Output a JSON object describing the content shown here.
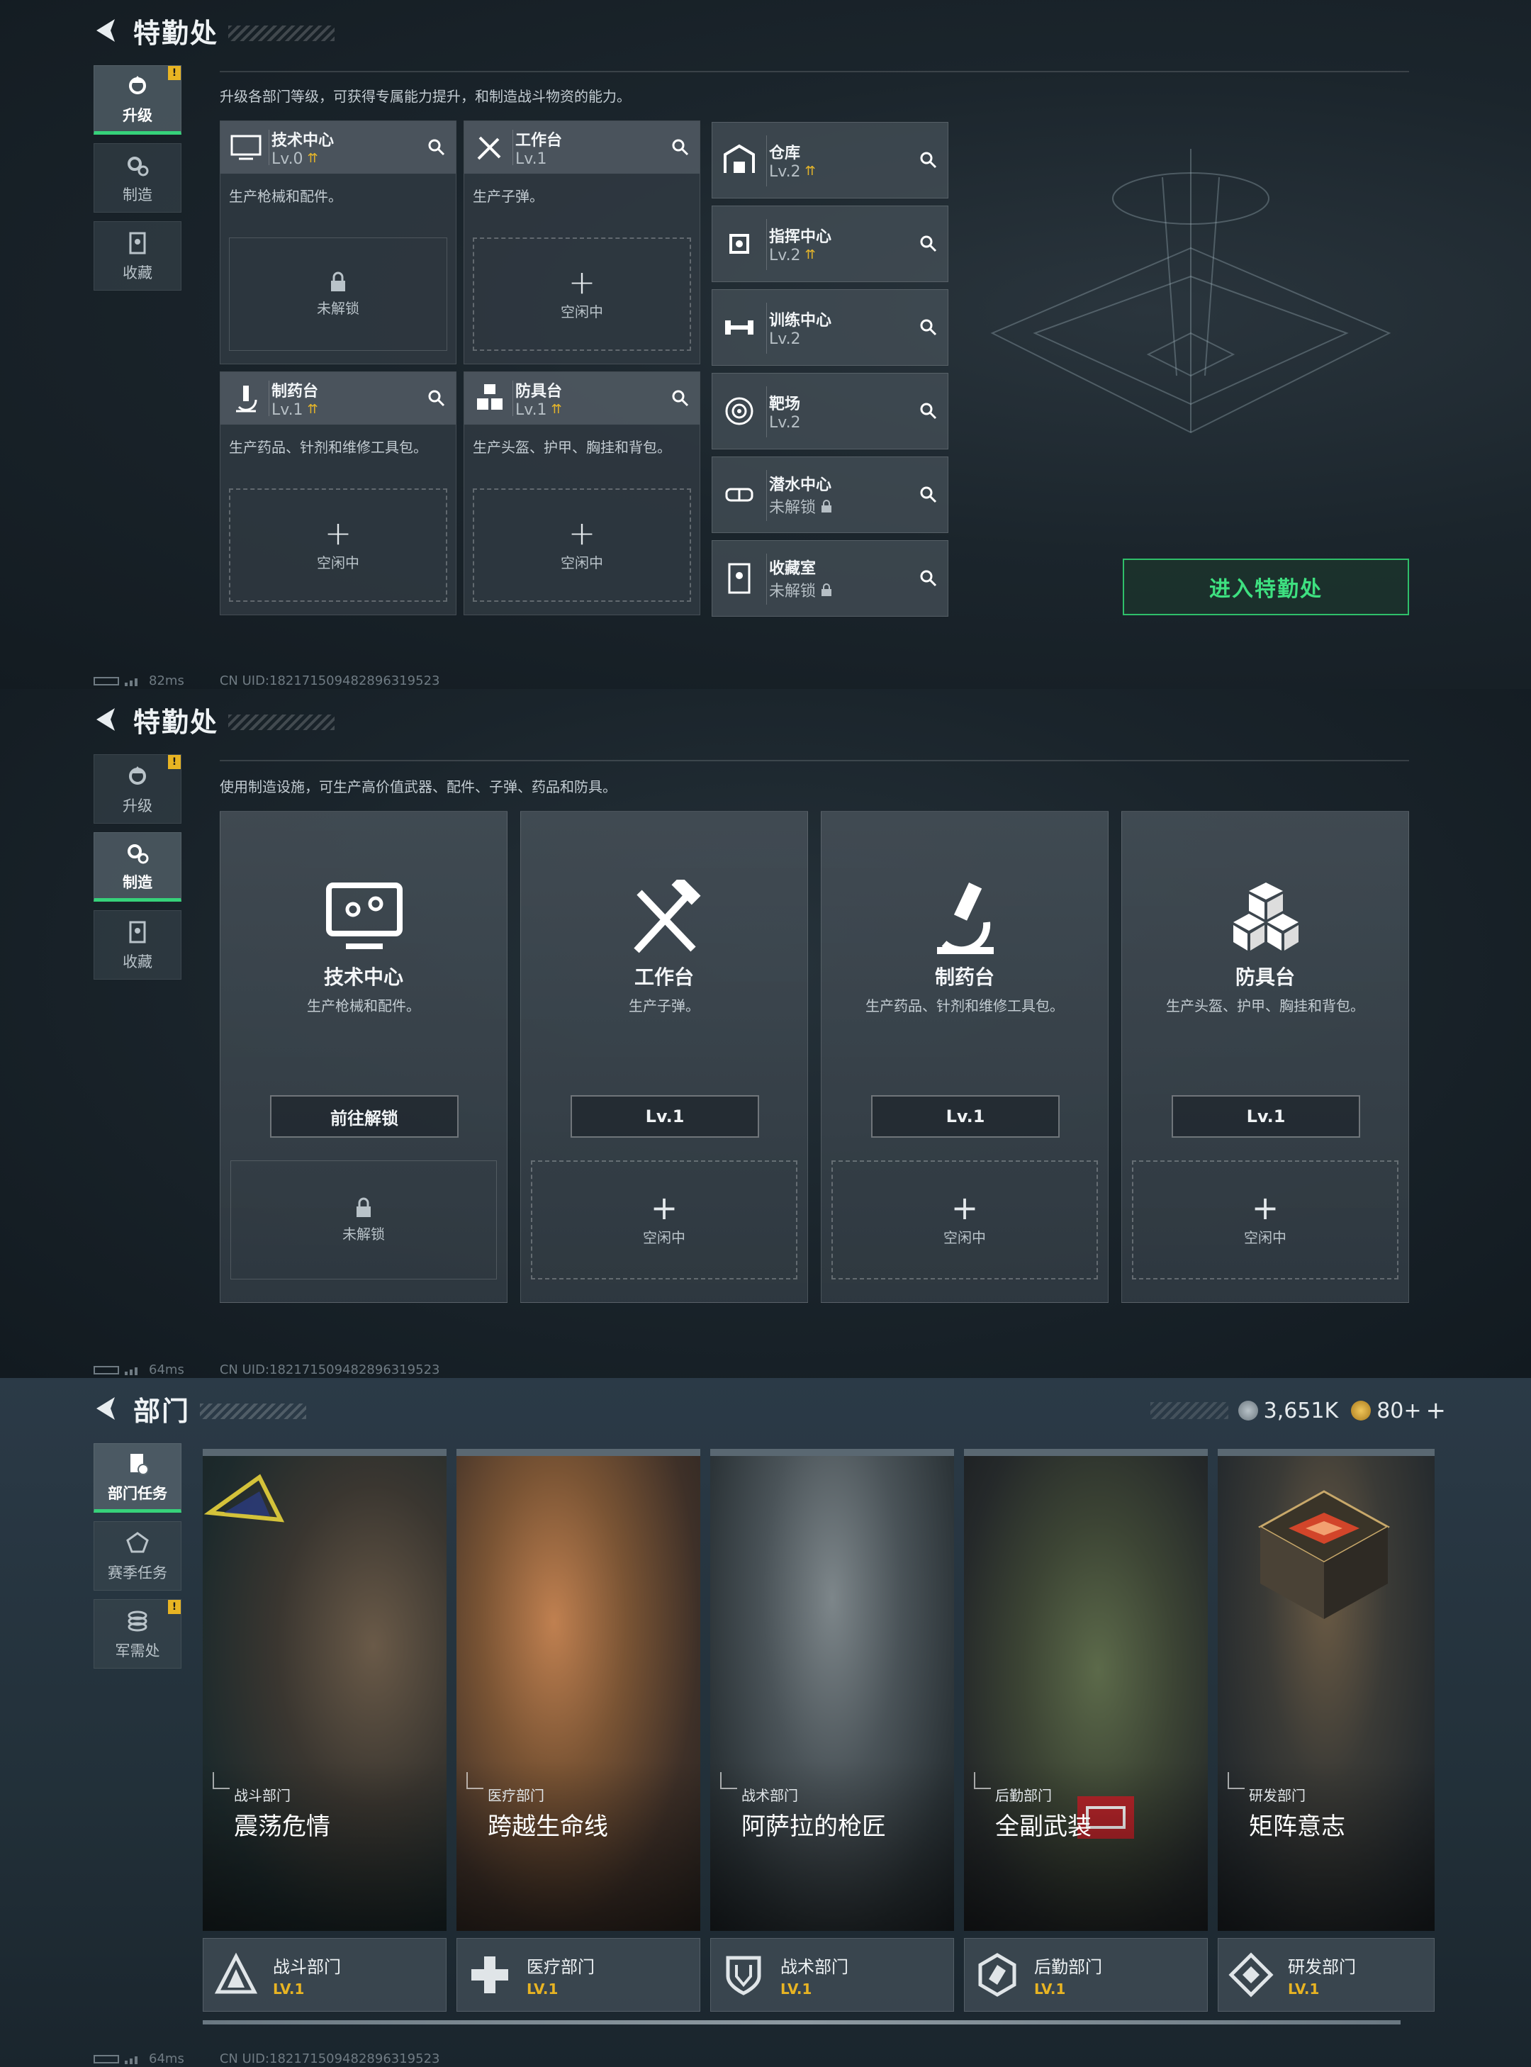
{
  "panel1": {
    "title": "特勤处",
    "tabs": [
      {
        "label": "升级",
        "badge": "!"
      },
      {
        "label": "制造"
      },
      {
        "label": "收藏"
      }
    ],
    "description": "升级各部门等级，可获得专属能力提升，和制造战斗物资的能力。",
    "facilities": [
      {
        "name": "技术中心",
        "level": "Lv.0",
        "desc": "生产枪械和配件。",
        "slot": "未解锁"
      },
      {
        "name": "工作台",
        "level": "Lv.1",
        "desc": "生产子弹。",
        "slot": "空闲中"
      },
      {
        "name": "制药台",
        "level": "Lv.1",
        "desc": "生产药品、针剂和维修工具包。",
        "slot": "空闲中"
      },
      {
        "name": "防具台",
        "level": "Lv.1",
        "desc": "生产头盔、护甲、胸挂和背包。",
        "slot": "空闲中"
      }
    ],
    "small_facilities": [
      {
        "name": "仓库",
        "level": "Lv.2"
      },
      {
        "name": "指挥中心",
        "level": "Lv.2"
      },
      {
        "name": "训练中心",
        "level": "Lv.2"
      },
      {
        "name": "靶场",
        "level": "Lv.2"
      },
      {
        "name": "潜水中心",
        "level": "未解锁"
      },
      {
        "name": "收藏室",
        "level": "未解锁"
      }
    ],
    "enter_button": "进入特勤处",
    "status": {
      "ping": "82ms",
      "uid": "CN UID:1821715094828963195​23"
    }
  },
  "panel2": {
    "title": "特勤处",
    "tabs": [
      {
        "label": "升级",
        "badge": "!"
      },
      {
        "label": "制造"
      },
      {
        "label": "收藏"
      }
    ],
    "description": "使用制造设施，可生产高价值武器、配件、子弹、药品和防具。",
    "stations": [
      {
        "name": "技术中心",
        "desc": "生产枪械和配件。",
        "button": "前往解锁",
        "slot": "未解锁",
        "icon": "monitor-icon"
      },
      {
        "name": "工作台",
        "desc": "生产子弹。",
        "button": "Lv.1",
        "slot": "空闲中",
        "icon": "hammer-wrench-icon"
      },
      {
        "name": "制药台",
        "desc": "生产药品、针剂和维修工具包。",
        "button": "Lv.1",
        "slot": "空闲中",
        "icon": "microscope-icon"
      },
      {
        "name": "防具台",
        "desc": "生产头盔、护甲、胸挂和背包。",
        "button": "Lv.1",
        "slot": "空闲中",
        "icon": "cubes-icon"
      }
    ],
    "status": {
      "ping": "64ms",
      "uid": "CN UID:182171509482896319523"
    }
  },
  "panel3": {
    "title": "部门",
    "currency": {
      "credits": "3,651K",
      "tokens": "80+"
    },
    "tabs": [
      {
        "label": "部门任务"
      },
      {
        "label": "赛季任务"
      },
      {
        "label": "军需处",
        "badge": "!"
      }
    ],
    "departments": [
      {
        "sub": "战斗部门",
        "title": "震荡危情",
        "name": "战斗部门",
        "level": "LV.1"
      },
      {
        "sub": "医疗部门",
        "title": "跨越生命线",
        "name": "医疗部门",
        "level": "LV.1"
      },
      {
        "sub": "战术部门",
        "title": "阿萨拉的枪匠",
        "name": "战术部门",
        "level": "LV.1"
      },
      {
        "sub": "后勤部门",
        "title": "全副武装",
        "name": "后勤部门",
        "level": "LV.1"
      },
      {
        "sub": "研发部门",
        "title": "矩阵意志",
        "name": "研发部门",
        "level": "LV.1"
      }
    ],
    "status": {
      "ping": "64ms",
      "uid": "CN UID:182171509482896319523"
    }
  },
  "colors": {
    "accent_green": "#36d27a",
    "level_gold": "#e8b423"
  }
}
